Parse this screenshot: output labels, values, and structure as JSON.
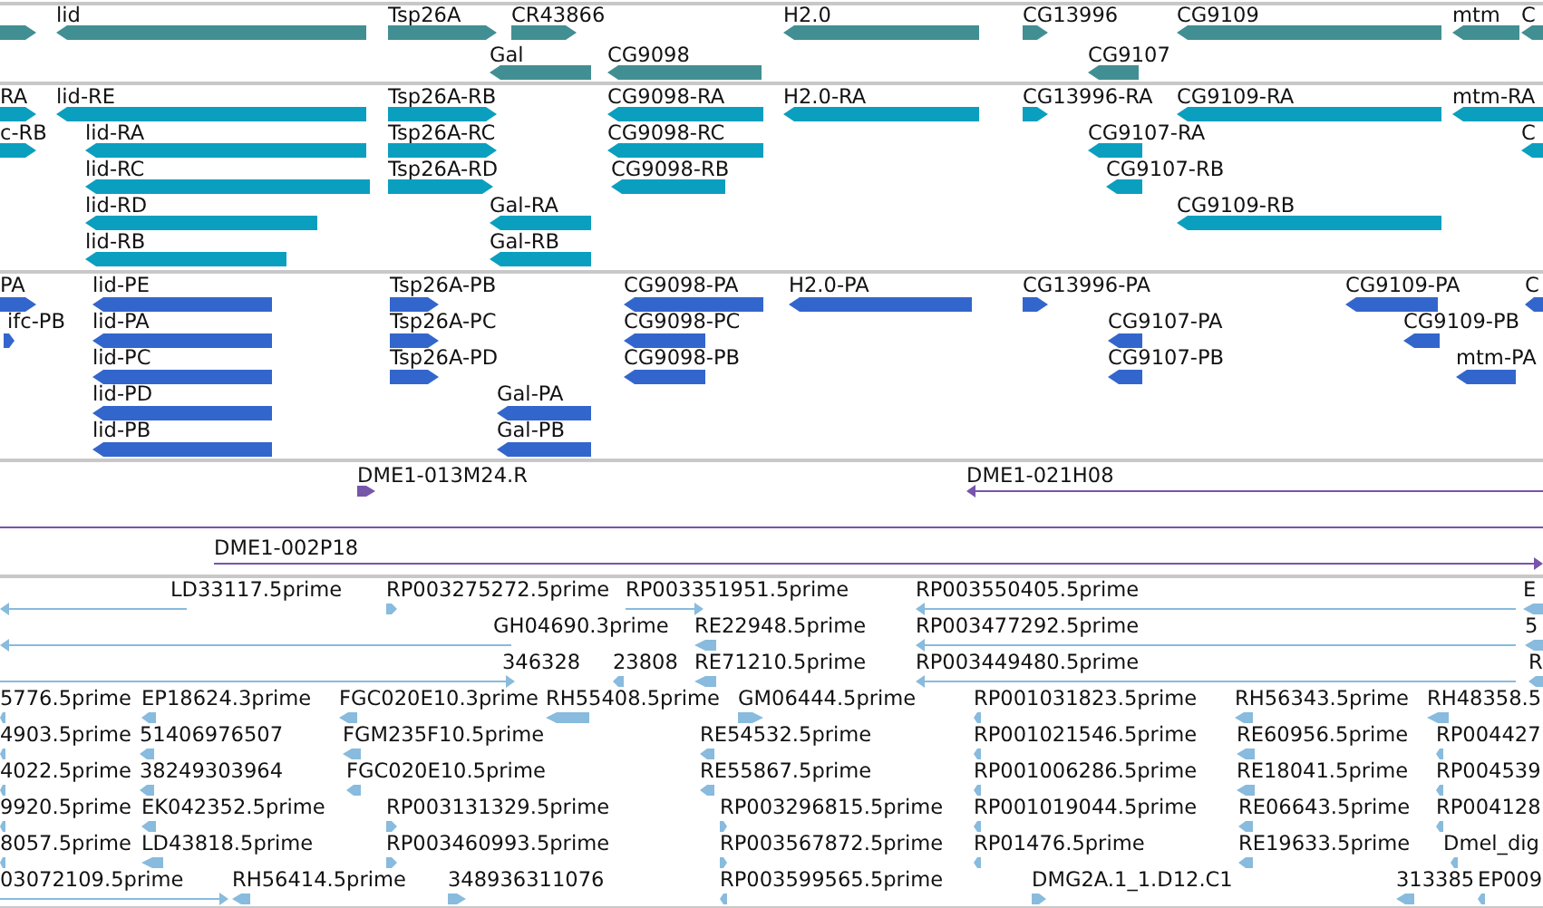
{
  "tracks": [
    {
      "kind": "gene",
      "features": [
        {
          "reverse": false
        },
        {
          "label": "lid",
          "reverse": true
        },
        {
          "label": "Tsp26A",
          "reverse": false
        },
        {
          "label": "CR43866",
          "reverse": false
        },
        {
          "label": "H2.0",
          "reverse": true
        },
        {
          "label": "CG13996",
          "reverse": false
        },
        {
          "label": "CG9109",
          "reverse": true
        },
        {
          "label": "mtm",
          "reverse": true
        },
        {
          "label": "C",
          "reverse": true
        },
        {
          "label": "Gal",
          "reverse": true
        },
        {
          "label": "CG9098",
          "reverse": true
        },
        {
          "label": "CG9107",
          "reverse": true
        }
      ]
    },
    {
      "kind": "transcript",
      "features": [
        {
          "label": "RA",
          "reverse": false
        },
        {
          "label": "lid-RE",
          "reverse": true
        },
        {
          "label": "Tsp26A-RB",
          "reverse": false
        },
        {
          "label": "CG9098-RA",
          "reverse": true
        },
        {
          "label": "H2.0-RA",
          "reverse": true
        },
        {
          "label": "CG13996-RA",
          "reverse": false
        },
        {
          "label": "CG9109-RA",
          "reverse": true
        },
        {
          "label": "mtm-RA",
          "reverse": true
        },
        {
          "label": "c-RB",
          "reverse": false
        },
        {
          "label": "lid-RA",
          "reverse": true
        },
        {
          "label": "Tsp26A-RC",
          "reverse": false
        },
        {
          "label": "CG9098-RC",
          "reverse": true
        },
        {
          "label": "CG9107-RA",
          "reverse": true
        },
        {
          "label": "C",
          "reverse": true
        },
        {
          "label": "lid-RC",
          "reverse": true
        },
        {
          "label": "Tsp26A-RD",
          "reverse": false
        },
        {
          "label": "CG9098-RB",
          "reverse": true
        },
        {
          "label": "CG9107-RB",
          "reverse": true
        },
        {
          "label": "lid-RD",
          "reverse": true
        },
        {
          "label": "Gal-RA",
          "reverse": true
        },
        {
          "label": "CG9109-RB",
          "reverse": true
        },
        {
          "label": "lid-RB",
          "reverse": true
        },
        {
          "label": "Gal-RB",
          "reverse": true
        }
      ]
    },
    {
      "kind": "protein",
      "features": [
        {
          "label": "PA",
          "reverse": false
        },
        {
          "label": "lid-PE",
          "reverse": true
        },
        {
          "label": "Tsp26A-PB",
          "reverse": false
        },
        {
          "label": "CG9098-PA",
          "reverse": true
        },
        {
          "label": "H2.0-PA",
          "reverse": true
        },
        {
          "label": "CG13996-PA",
          "reverse": false
        },
        {
          "label": "CG9109-PA",
          "reverse": true
        },
        {
          "label": "C",
          "reverse": true
        },
        {
          "label": "ifc-PB",
          "reverse": false
        },
        {
          "label": "lid-PA",
          "reverse": true
        },
        {
          "label": "Tsp26A-PC",
          "reverse": false
        },
        {
          "label": "CG9098-PC",
          "reverse": true
        },
        {
          "label": "CG9107-PA",
          "reverse": true
        },
        {
          "label": "CG9109-PB",
          "reverse": true
        },
        {
          "label": "lid-PC",
          "reverse": true
        },
        {
          "label": "Tsp26A-PD",
          "reverse": false
        },
        {
          "label": "CG9098-PB",
          "reverse": true
        },
        {
          "label": "CG9107-PB",
          "reverse": true
        },
        {
          "label": "mtm-PA",
          "reverse": true
        },
        {
          "label": "lid-PD",
          "reverse": true
        },
        {
          "label": "Gal-PA",
          "reverse": true
        },
        {
          "label": "lid-PB",
          "reverse": true
        },
        {
          "label": "Gal-PB",
          "reverse": true
        }
      ]
    },
    {
      "kind": "clone",
      "features": [
        {
          "label": "DME1-013M24.R",
          "reverse": false
        },
        {
          "label": "DME1-021H08",
          "reverse": true
        },
        {
          "reverse": false
        },
        {
          "label": "DME1-002P18",
          "reverse": false
        }
      ]
    },
    {
      "kind": "est",
      "features": [
        {
          "label": "LD33117.5prime",
          "reverse": true
        },
        {
          "label": "RP003275272.5prime",
          "reverse": false
        },
        {
          "label": "RP003351951.5prime",
          "reverse": false
        },
        {
          "label": "RP003550405.5prime",
          "reverse": true
        },
        {
          "label": "E",
          "reverse": true
        },
        {
          "label": "GH04690.3prime",
          "reverse": true
        },
        {
          "label": "RE22948.5prime",
          "reverse": true
        },
        {
          "label": "RP003477292.5prime",
          "reverse": true
        },
        {
          "label": "5",
          "reverse": true
        },
        {
          "label": "346328",
          "reverse": false
        },
        {
          "label": "23808",
          "reverse": true
        },
        {
          "label": "RE71210.5prime",
          "reverse": true
        },
        {
          "label": "RP003449480.5prime",
          "reverse": true
        },
        {
          "label": "R",
          "reverse": true
        },
        {
          "label": "5776.5prime",
          "reverse": true
        },
        {
          "label": "EP18624.3prime",
          "reverse": true
        },
        {
          "label": "FGC020E10.3prime",
          "reverse": true
        },
        {
          "label": "RH55408.5prime",
          "reverse": true
        },
        {
          "label": "GM06444.5prime",
          "reverse": false
        },
        {
          "label": "RP001031823.5prime",
          "reverse": true
        },
        {
          "label": "RH56343.5prime",
          "reverse": true
        },
        {
          "label": "RH48358.5",
          "reverse": true
        },
        {
          "label": "4903.5prime",
          "reverse": true
        },
        {
          "label": "51406976507",
          "reverse": true
        },
        {
          "label": "FGM235F10.5prime",
          "reverse": true
        },
        {
          "label": "RE54532.5prime",
          "reverse": true
        },
        {
          "label": "RP001021546.5prime",
          "reverse": true
        },
        {
          "label": "RE60956.5prime",
          "reverse": true
        },
        {
          "label": "RP004427",
          "reverse": true
        },
        {
          "label": "4022.5prime",
          "reverse": true
        },
        {
          "label": "38249303964",
          "reverse": true
        },
        {
          "label": "FGC020E10.5prime",
          "reverse": true
        },
        {
          "label": "RE55867.5prime",
          "reverse": true
        },
        {
          "label": "RP001006286.5prime",
          "reverse": true
        },
        {
          "label": "RE18041.5prime",
          "reverse": true
        },
        {
          "label": "RP004539",
          "reverse": true
        },
        {
          "label": "9920.5prime",
          "reverse": true
        },
        {
          "label": "EK042352.5prime",
          "reverse": true
        },
        {
          "label": "RP003131329.5prime",
          "reverse": false
        },
        {
          "label": "RP003296815.5prime",
          "reverse": false
        },
        {
          "label": "RP001019044.5prime",
          "reverse": true
        },
        {
          "label": "RE06643.5prime",
          "reverse": true
        },
        {
          "label": "RP004128",
          "reverse": true
        },
        {
          "label": "8057.5prime",
          "reverse": true
        },
        {
          "label": "LD43818.5prime",
          "reverse": true
        },
        {
          "label": "RP003460993.5prime",
          "reverse": false
        },
        {
          "label": "RP003567872.5prime",
          "reverse": false
        },
        {
          "label": "RP01476.5prime",
          "reverse": true
        },
        {
          "label": "RE19633.5prime",
          "reverse": true
        },
        {
          "label": "Dmel_dig",
          "reverse": true
        },
        {
          "label": "03072109.5prime",
          "reverse": false
        },
        {
          "label": "RH56414.5prime",
          "reverse": true
        },
        {
          "label": "348936311076",
          "reverse": false
        },
        {
          "label": "RP003599565.5prime",
          "reverse": true
        },
        {
          "label": "DMG2A.1_1.D12.C1",
          "reverse": false
        },
        {
          "label": "313385",
          "reverse": true
        },
        {
          "label": "EP009",
          "reverse": true
        }
      ]
    }
  ]
}
